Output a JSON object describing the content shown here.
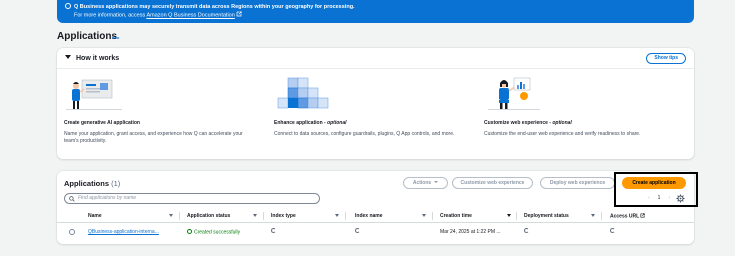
{
  "banner": {
    "line1": "Q Business applications may securely transmit data across Regions within your geography for processing.",
    "line2_prefix": "For more information, access",
    "line2_link": "Amazon Q Business Documentation"
  },
  "page": {
    "title": "Applications",
    "info_link": "Info"
  },
  "how_it_works": {
    "title": "How it works",
    "show_tips": "Show tips",
    "steps": [
      {
        "title": "Create generative AI application",
        "optional": "",
        "description": "Name your application, grant access, and experience how Q can accelerate your team's productivity."
      },
      {
        "title": "Enhance application - ",
        "optional": "optional",
        "description": "Connect to data sources, configure guardrails, plugins, Q App controls, and more."
      },
      {
        "title": "Customize web experience - ",
        "optional": "optional",
        "description": "Customize the end-user web experience and verify readiness to share."
      }
    ]
  },
  "applications": {
    "title": "Applications",
    "count": "(1)",
    "buttons": {
      "actions": "Actions",
      "customize": "Customize web experience",
      "deploy": "Deploy web experience",
      "create": "Create application"
    },
    "search_placeholder": "Find applications by name",
    "pagination": {
      "prev": "‹",
      "page": "1",
      "next": "›"
    },
    "columns": [
      "Name",
      "Application status",
      "Index type",
      "Index name",
      "Creation time",
      "Deployment status",
      "Access URL"
    ],
    "rows": [
      {
        "name": "QBusiness-application-interna...",
        "status": "Created successfully",
        "creation_time": "Mar 24, 2025 at 1:22 PM ..."
      }
    ]
  },
  "colors": {
    "banner": "#0972d3",
    "primary": "#ff9900",
    "link": "#0972d3",
    "success": "#037f0c"
  }
}
